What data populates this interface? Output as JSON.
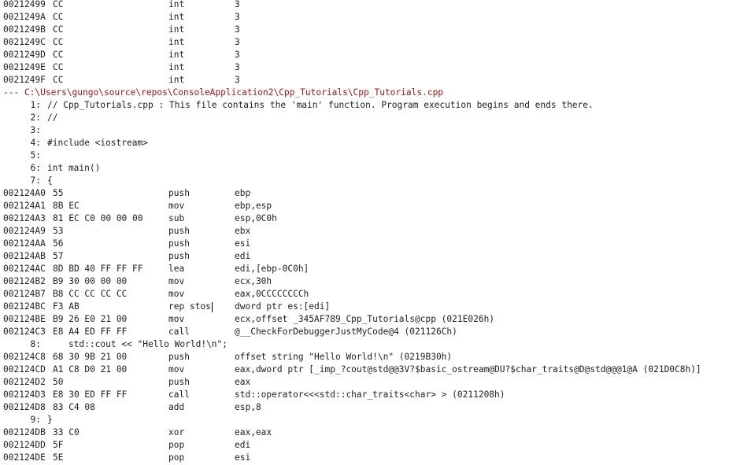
{
  "colors": {
    "background": "#ffffff",
    "text": "#1e1e1e",
    "file_header": "#a31515"
  },
  "disassembly": {
    "lines": [
      {
        "kind": "instr",
        "address": "00212499",
        "bytes": "CC",
        "mnemonic": "int",
        "operands": "3"
      },
      {
        "kind": "instr",
        "address": "0021249A",
        "bytes": "CC",
        "mnemonic": "int",
        "operands": "3"
      },
      {
        "kind": "instr",
        "address": "0021249B",
        "bytes": "CC",
        "mnemonic": "int",
        "operands": "3"
      },
      {
        "kind": "instr",
        "address": "0021249C",
        "bytes": "CC",
        "mnemonic": "int",
        "operands": "3"
      },
      {
        "kind": "instr",
        "address": "0021249D",
        "bytes": "CC",
        "mnemonic": "int",
        "operands": "3"
      },
      {
        "kind": "instr",
        "address": "0021249E",
        "bytes": "CC",
        "mnemonic": "int",
        "operands": "3"
      },
      {
        "kind": "instr",
        "address": "0021249F",
        "bytes": "CC",
        "mnemonic": "int",
        "operands": "3"
      },
      {
        "kind": "file",
        "text": "--- C:\\Users\\gungo\\source\\repos\\ConsoleApplication2\\Cpp_Tutorials\\Cpp_Tutorials.cpp"
      },
      {
        "kind": "source",
        "num": "1:",
        "code": "// Cpp_Tutorials.cpp : This file contains the 'main' function. Program execution begins and ends there."
      },
      {
        "kind": "source",
        "num": "2:",
        "code": "//"
      },
      {
        "kind": "source",
        "num": "3:",
        "code": ""
      },
      {
        "kind": "source",
        "num": "4:",
        "code": "#include <iostream>"
      },
      {
        "kind": "source",
        "num": "5:",
        "code": ""
      },
      {
        "kind": "source",
        "num": "6:",
        "code": "int main()"
      },
      {
        "kind": "source",
        "num": "7:",
        "code": "{"
      },
      {
        "kind": "instr",
        "address": "002124A0",
        "bytes": "55",
        "mnemonic": "push",
        "operands": "ebp"
      },
      {
        "kind": "instr",
        "address": "002124A1",
        "bytes": "8B EC",
        "mnemonic": "mov",
        "operands": "ebp,esp"
      },
      {
        "kind": "instr",
        "address": "002124A3",
        "bytes": "81 EC C0 00 00 00",
        "mnemonic": "sub",
        "operands": "esp,0C0h"
      },
      {
        "kind": "instr",
        "address": "002124A9",
        "bytes": "53",
        "mnemonic": "push",
        "operands": "ebx"
      },
      {
        "kind": "instr",
        "address": "002124AA",
        "bytes": "56",
        "mnemonic": "push",
        "operands": "esi"
      },
      {
        "kind": "instr",
        "address": "002124AB",
        "bytes": "57",
        "mnemonic": "push",
        "operands": "edi"
      },
      {
        "kind": "instr",
        "address": "002124AC",
        "bytes": "8D BD 40 FF FF FF",
        "mnemonic": "lea",
        "operands": "edi,[ebp-0C0h]"
      },
      {
        "kind": "instr",
        "address": "002124B2",
        "bytes": "B9 30 00 00 00",
        "mnemonic": "mov",
        "operands": "ecx,30h"
      },
      {
        "kind": "instr",
        "address": "002124B7",
        "bytes": "B8 CC CC CC CC",
        "mnemonic": "mov",
        "operands": "eax,0CCCCCCCCh"
      },
      {
        "kind": "instr",
        "address": "002124BC",
        "bytes": "F3 AB",
        "mnemonic": "rep stos",
        "operands": "dword ptr es:[edi]",
        "caret": true
      },
      {
        "kind": "instr",
        "address": "002124BE",
        "bytes": "B9 26 E0 21 00",
        "mnemonic": "mov",
        "operands": "ecx,offset _345AF789_Cpp_Tutorials@cpp (021E026h)"
      },
      {
        "kind": "instr",
        "address": "002124C3",
        "bytes": "E8 A4 ED FF FF",
        "mnemonic": "call",
        "operands": "@__CheckForDebuggerJustMyCode@4 (021126Ch)"
      },
      {
        "kind": "source",
        "num": "8:",
        "code": "    std::cout << \"Hello World!\\n\";"
      },
      {
        "kind": "instr",
        "address": "002124C8",
        "bytes": "68 30 9B 21 00",
        "mnemonic": "push",
        "operands": "offset string \"Hello World!\\n\" (0219B30h)"
      },
      {
        "kind": "instr",
        "address": "002124CD",
        "bytes": "A1 C8 D0 21 00",
        "mnemonic": "mov",
        "operands": "eax,dword ptr [_imp_?cout@std@@3V?$basic_ostream@DU?$char_traits@D@std@@@1@A (021D0C8h)]"
      },
      {
        "kind": "instr",
        "address": "002124D2",
        "bytes": "50",
        "mnemonic": "push",
        "operands": "eax"
      },
      {
        "kind": "instr",
        "address": "002124D3",
        "bytes": "E8 30 ED FF FF",
        "mnemonic": "call",
        "operands": "std::operator<<<std::char_traits<char> > (0211208h)"
      },
      {
        "kind": "instr",
        "address": "002124D8",
        "bytes": "83 C4 08",
        "mnemonic": "add",
        "operands": "esp,8"
      },
      {
        "kind": "source",
        "num": "9:",
        "code": "}"
      },
      {
        "kind": "instr",
        "address": "002124DB",
        "bytes": "33 C0",
        "mnemonic": "xor",
        "operands": "eax,eax"
      },
      {
        "kind": "instr",
        "address": "002124DD",
        "bytes": "5F",
        "mnemonic": "pop",
        "operands": "edi"
      },
      {
        "kind": "instr",
        "address": "002124DE",
        "bytes": "5E",
        "mnemonic": "pop",
        "operands": "esi"
      }
    ]
  }
}
